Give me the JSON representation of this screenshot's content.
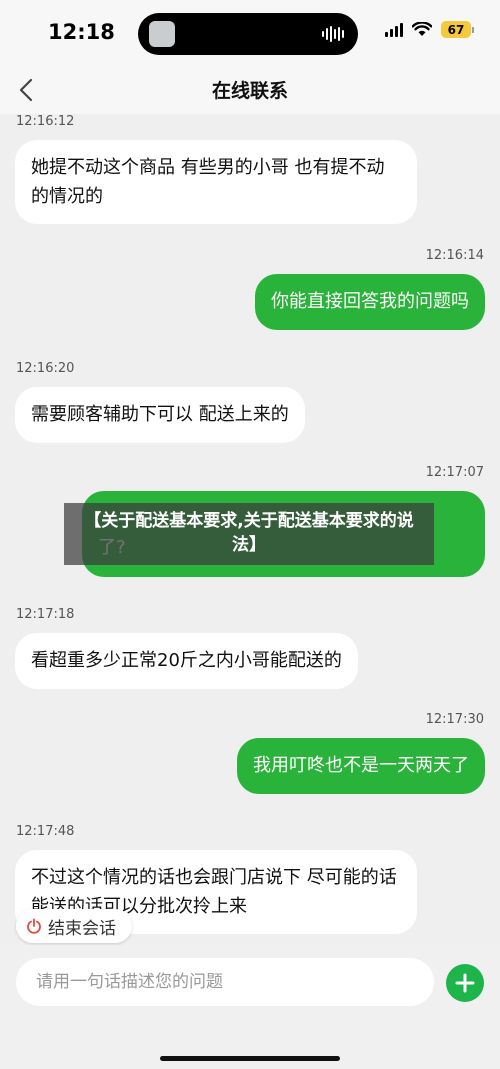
{
  "status_bar": {
    "time": "12:18",
    "battery": "67"
  },
  "nav": {
    "title": "在线联系"
  },
  "messages": [
    {
      "time": "12:16:12",
      "text": "她提不动这个商品 有些男的小哥 也有提不动的情况的"
    },
    {
      "time": "12:16:14",
      "text": "你能直接回答我的问题吗"
    },
    {
      "time": "12:16:20",
      "text": "需要顾客辅助下可以 配送上来的"
    },
    {
      "time": "12:17:07",
      "text": "了?"
    },
    {
      "time": "12:17:18",
      "text": "看超重多少正常20斤之内小哥能配送的"
    },
    {
      "time": "12:17:30",
      "text": "我用叮咚也不是一天两天了"
    },
    {
      "time": "12:17:48",
      "text": "不过这个情况的话也会跟门店说下 尽可能的话能送的话可以分批次拎上来"
    }
  ],
  "overlay": {
    "text": "【关于配送基本要求,关于配送基本要求的说法】"
  },
  "end_chat": {
    "label": "结束会话"
  },
  "input": {
    "placeholder": "请用一句话描述您的问题"
  },
  "colors": {
    "accent": "#2ab33a",
    "add_button": "#1db54a",
    "battery": "#f5c93b"
  }
}
